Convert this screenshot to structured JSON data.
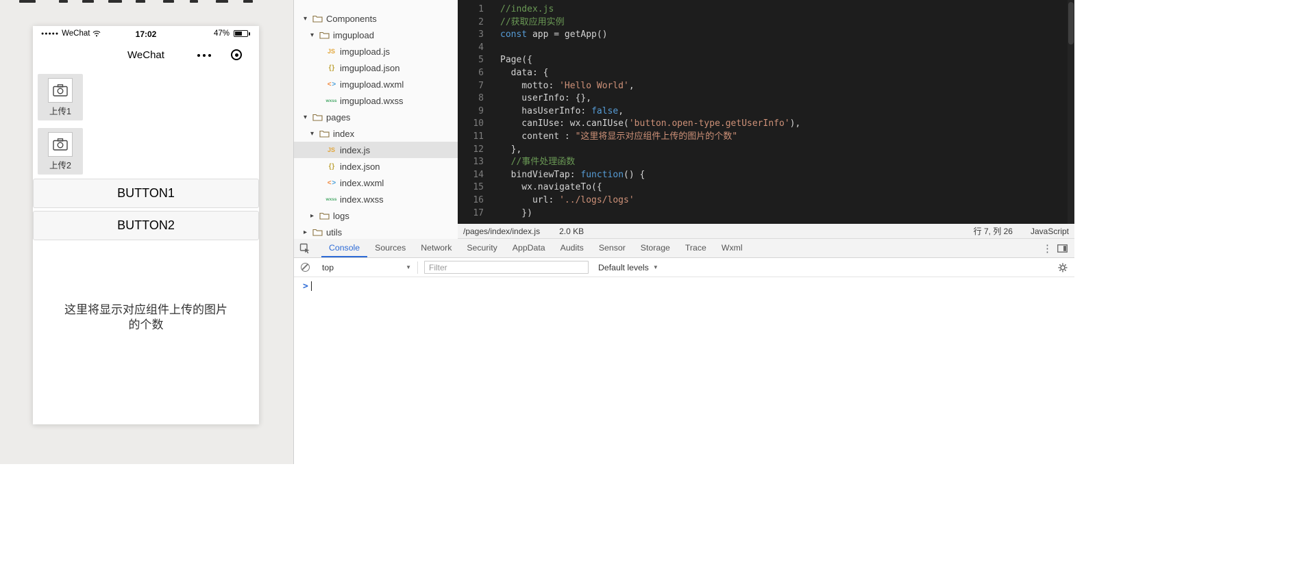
{
  "colors": {
    "accent_blue": "#2c6ad6",
    "editor_background": "#1d1d1d",
    "token_comment": "#6a9955",
    "token_keyword": "#569cd6",
    "token_string": "#ce9178",
    "token_plain": "#d4d4d4"
  },
  "simulator": {
    "status_bar": {
      "signal_dots": "●●●●●",
      "carrier": "WeChat",
      "time": "17:02",
      "battery": "47%"
    },
    "nav_bar": {
      "title": "WeChat"
    },
    "upload_tiles": [
      {
        "label": "上传1"
      },
      {
        "label": "上传2"
      }
    ],
    "buttons": [
      {
        "label": "BUTTON1"
      },
      {
        "label": "BUTTON2"
      }
    ],
    "placeholder_text": "这里将显示对应组件上传的图片的个数"
  },
  "file_tree": {
    "items": [
      {
        "label": "Components",
        "type": "folder",
        "depth": 0,
        "expanded": true
      },
      {
        "label": "imgupload",
        "type": "folder",
        "depth": 1,
        "expanded": true
      },
      {
        "label": "imgupload.js",
        "type": "js",
        "depth": 2
      },
      {
        "label": "imgupload.json",
        "type": "json",
        "depth": 2
      },
      {
        "label": "imgupload.wxml",
        "type": "wxml",
        "depth": 2
      },
      {
        "label": "imgupload.wxss",
        "type": "wxss",
        "depth": 2
      },
      {
        "label": "pages",
        "type": "folder",
        "depth": 0,
        "expanded": true
      },
      {
        "label": "index",
        "type": "folder",
        "depth": 1,
        "expanded": true
      },
      {
        "label": "index.js",
        "type": "js",
        "depth": 2,
        "selected": true
      },
      {
        "label": "index.json",
        "type": "json",
        "depth": 2
      },
      {
        "label": "index.wxml",
        "type": "wxml",
        "depth": 2
      },
      {
        "label": "index.wxss",
        "type": "wxss",
        "depth": 2
      },
      {
        "label": "logs",
        "type": "folder",
        "depth": 1,
        "expanded": false
      },
      {
        "label": "utils",
        "type": "folder",
        "depth": 0,
        "expanded": false
      }
    ]
  },
  "editor": {
    "lines": [
      [
        [
          "c",
          "//index.js"
        ]
      ],
      [
        [
          "c",
          "//获取应用实例"
        ]
      ],
      [
        [
          "k",
          "const"
        ],
        [
          "p",
          " app = getApp()"
        ]
      ],
      [],
      [
        [
          "p",
          "Page({"
        ]
      ],
      [
        [
          "p",
          "  data: {"
        ]
      ],
      [
        [
          "p",
          "    motto: "
        ],
        [
          "s",
          "'Hello World'"
        ],
        [
          "p",
          ","
        ]
      ],
      [
        [
          "p",
          "    userInfo: {},"
        ]
      ],
      [
        [
          "p",
          "    hasUserInfo: "
        ],
        [
          "k",
          "false"
        ],
        [
          "p",
          ","
        ]
      ],
      [
        [
          "p",
          "    canIUse: wx.canIUse("
        ],
        [
          "s",
          "'button.open-type.getUserInfo'"
        ],
        [
          "p",
          "),"
        ]
      ],
      [
        [
          "p",
          "    content : "
        ],
        [
          "s",
          "\"这里将显示对应组件上传的图片的个数\""
        ]
      ],
      [
        [
          "p",
          "  },"
        ]
      ],
      [
        [
          "c",
          "  //事件处理函数"
        ]
      ],
      [
        [
          "p",
          "  bindViewTap: "
        ],
        [
          "k",
          "function"
        ],
        [
          "p",
          "() {"
        ]
      ],
      [
        [
          "p",
          "    wx.navigateTo({"
        ]
      ],
      [
        [
          "p",
          "      url: "
        ],
        [
          "s",
          "'../logs/logs'"
        ]
      ],
      [
        [
          "p",
          "    })"
        ]
      ]
    ],
    "status_bar": {
      "file_path": "/pages/index/index.js",
      "file_size": "2.0 KB",
      "cursor_position": "行 7, 列 26",
      "language": "JavaScript"
    }
  },
  "devtools": {
    "tabs": [
      "Console",
      "Sources",
      "Network",
      "Security",
      "AppData",
      "Audits",
      "Sensor",
      "Storage",
      "Trace",
      "Wxml"
    ],
    "active_tab": "Console",
    "toolbar": {
      "context_selector": "top",
      "filter_placeholder": "Filter",
      "log_level": "Default levels"
    },
    "console_prompt": ">"
  }
}
